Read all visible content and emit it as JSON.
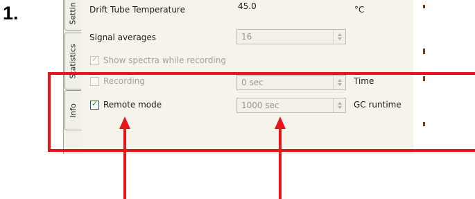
{
  "step_label": "1.",
  "tabs": [
    {
      "label": "Settin"
    },
    {
      "label": "Statistics"
    },
    {
      "label": "Info"
    }
  ],
  "rows": {
    "drift_tube": {
      "label": "Drift Tube Temperature",
      "value": "45.0",
      "unit": "°C"
    },
    "signal_averages": {
      "label": "Signal averages",
      "value": "16"
    },
    "show_spectra": {
      "label": "Show spectra while recording",
      "checked": true,
      "enabled": false
    },
    "recording": {
      "label": "Recording",
      "checked": false,
      "enabled": false,
      "value": "0 sec",
      "unit": "Time"
    },
    "remote_mode": {
      "label": "Remote mode",
      "checked": true,
      "enabled": true,
      "value": "1000 sec",
      "unit": "GC runtime"
    }
  },
  "check_glyph": "✓",
  "annotation": {
    "box_color": "#e8141b",
    "arrow_color": "#e8141b"
  },
  "colors": {
    "panel_bg": "#f6f3ea",
    "disabled_text": "#a3a29a"
  },
  "icons": [
    "spin-up-icon",
    "spin-down-icon",
    "checkmark-icon",
    "arrow-up-icon"
  ]
}
